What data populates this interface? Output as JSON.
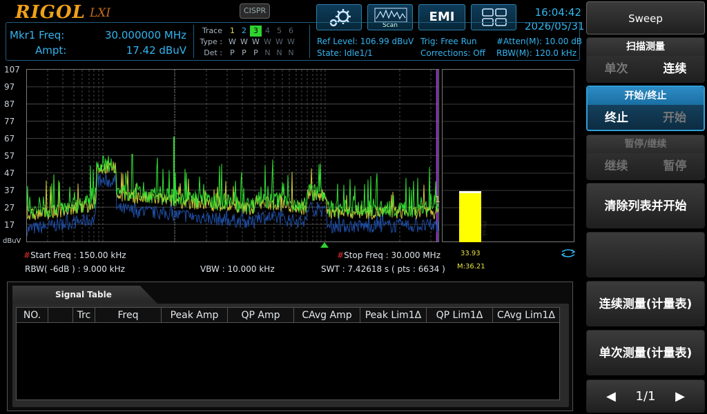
{
  "header": {
    "brand": "RIGOL",
    "lxi": "LXI",
    "cispr_label": "CISPR",
    "scan_label": "Scan",
    "emi_label": "EMI",
    "time": "16:04:42",
    "date": "2026/05/31"
  },
  "marker": {
    "freq_label": "Mkr1 Freq:",
    "freq_value": "30.000000 MHz",
    "ampt_label": "Ampt:",
    "ampt_value": "17.42 dBuV"
  },
  "traces": {
    "trace_label": "Trace :",
    "type_label": "Type :",
    "det_label": "Det :",
    "numbers": [
      "1",
      "2",
      "3",
      "4",
      "5",
      "6"
    ],
    "types": [
      "W",
      "W",
      "W",
      "W",
      "W",
      "W"
    ],
    "dets": [
      "P",
      "P",
      "P",
      "N",
      "N",
      "N"
    ]
  },
  "settings": {
    "ref_level": "Ref Level: 106.99 dBuV",
    "state": "State: Idle1/1",
    "trig": "Trig: Free Run",
    "corrections": "Corrections: Off",
    "atten": "#Atten(M): 10.00 dB",
    "rbw_m": "RBW(M): 120.0 kHz"
  },
  "plot": {
    "y_unit": "dBuV",
    "y_ticks": [
      "107",
      "97",
      "87",
      "77",
      "67",
      "57",
      "47",
      "37",
      "27",
      "17"
    ],
    "start_freq": "Start Freq : 150.00 kHz",
    "stop_freq": "Stop Freq : 30.000 MHz",
    "rbw": "RBW( -6dB ) : 9.000 kHz",
    "vbw": "VBW : 10.000 kHz",
    "swt": "SWT : 7.42618 s ( pts : 6634 )",
    "peak_bar_label": "Peak",
    "peak_bar_value": "33.93",
    "peak_bar_max": "M:36.21",
    "marker_tag": "1",
    "colors": {
      "trace1": "#d2c93a",
      "trace2": "#1f4fa8",
      "trace3": "#33e033",
      "peak_bar": "#ffff00"
    }
  },
  "signal_table": {
    "title": "Signal Table",
    "columns": [
      "NO.",
      "",
      "Trc",
      "Freq",
      "Peak Amp",
      "QP Amp",
      "CAvg Amp",
      "Peak Lim1Δ",
      "QP Lim1Δ",
      "CAvg Lim1Δ"
    ]
  },
  "softkeys": {
    "menu_title": "Sweep",
    "scan_meas": {
      "head": "扫描测量",
      "opt1": "单次",
      "opt2": "连续"
    },
    "start_stop": {
      "head": "开始/终止",
      "opt1": "终止",
      "opt2": "开始"
    },
    "pause_resume": {
      "head": "暂停/继续",
      "opt1": "继续",
      "opt2": "暂停"
    },
    "clear_restart": "清除列表并开始",
    "cont_meter": "连续测量(计量表)",
    "single_meter": "单次测量(计量表)",
    "page": "1/1"
  }
}
